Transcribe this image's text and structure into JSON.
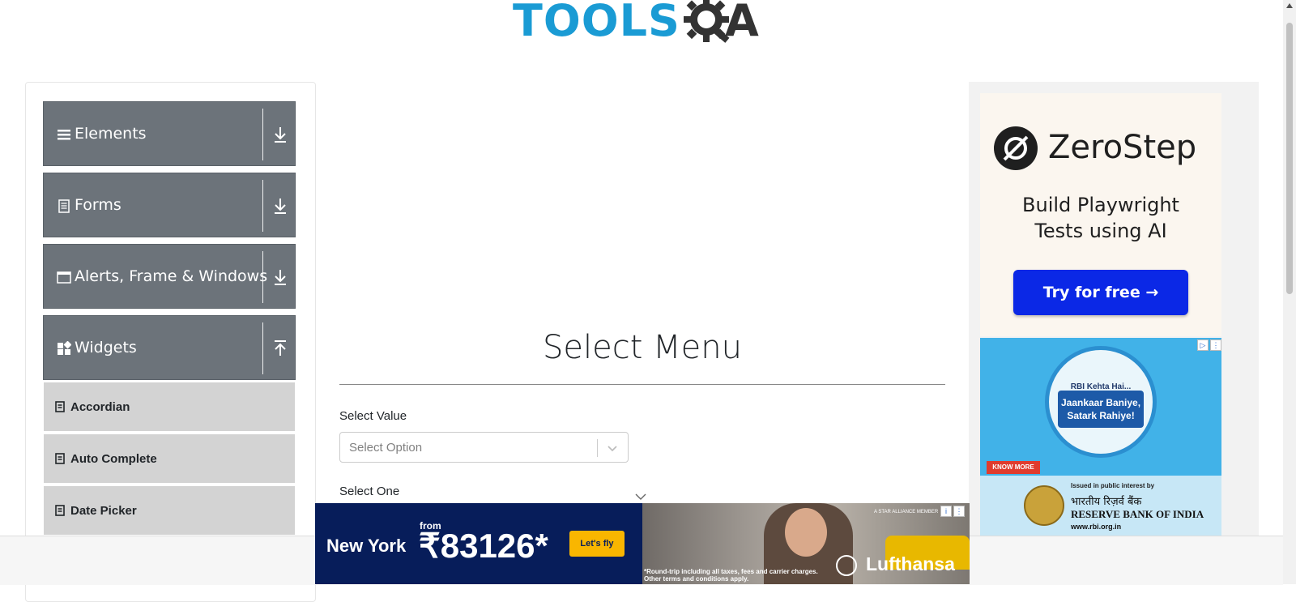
{
  "header": {
    "logo_part1": "TOOLS",
    "logo_part2": "A",
    "logo_color": "#1a9bd4"
  },
  "sidebar": {
    "groups": [
      {
        "label": "Elements",
        "icon": "hamburger-icon",
        "expanded": false
      },
      {
        "label": "Forms",
        "icon": "document-icon",
        "expanded": false
      },
      {
        "label": "Alerts, Frame & Windows",
        "icon": "window-icon",
        "expanded": false
      },
      {
        "label": "Widgets",
        "icon": "widgets-icon",
        "expanded": true
      }
    ],
    "items": [
      {
        "label": "Accordian"
      },
      {
        "label": "Auto Complete"
      },
      {
        "label": "Date Picker"
      }
    ],
    "header_color": "#6c737a",
    "item_color": "#d3d3d3"
  },
  "main": {
    "title": "Select Menu",
    "select_value": {
      "label": "Select Value",
      "placeholder": "Select Option"
    },
    "select_one": {
      "label": "Select One"
    }
  },
  "right_ad": {
    "brand": "ZeroStep",
    "tagline_line1": "Build Playwright",
    "tagline_line2": "Tests using AI",
    "cta": "Try for free →",
    "cta_color": "#0b28e6",
    "rbi": {
      "kehta": "RBI Kehta Hai...",
      "slogan_line1": "Jaankaar Baniye,",
      "slogan_line2": "Satark Rahiye!",
      "know_more": "KNOW MORE",
      "issued": "Issued in public interest by",
      "name_hindi": "भारतीय रिज़र्व बैंक",
      "name_english": "RESERVE BANK OF INDIA",
      "url": "www.rbi.org.in"
    }
  },
  "banner": {
    "city": "New York",
    "from": "from",
    "price": "₹83126*",
    "cta": "Let's fly",
    "fine_line1": "*Round-trip including all taxes, fees and carrier charges.",
    "fine_line2": "Other terms and conditions apply.",
    "alliance": "A STAR ALLIANCE MEMBER",
    "brand": "Lufthansa"
  }
}
